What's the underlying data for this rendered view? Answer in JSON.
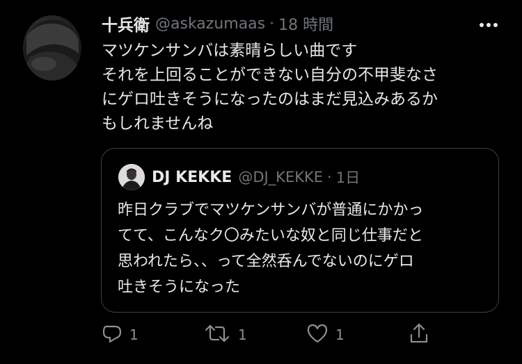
{
  "tweet": {
    "display_name": "十兵衛",
    "handle": "@askazumaas",
    "separator": "·",
    "time": "18 時間",
    "text_lines": [
      "マツケンサンバは素晴らしい曲です",
      "それを上回ることができない自分の不甲斐なさ",
      "にゲロ吐きそうになったのはまだ見込みあるか",
      "もしれませんね"
    ],
    "more_icon": "more-dots-icon"
  },
  "quote": {
    "display_name": "DJ KEKKE",
    "handle": "@DJ_KEKKE",
    "separator": "·",
    "time": "1日",
    "text_lines": [
      "昨日クラブでマツケンサンバが普通にかかっ",
      "てて、こんなク〇みたいな奴と同じ仕事だと",
      "思われたら、、って全然呑んでないのにゲロ",
      "吐きそうになった"
    ]
  },
  "actions": {
    "reply": {
      "icon": "reply-icon",
      "count": "1"
    },
    "retweet": {
      "icon": "retweet-icon",
      "count": "1"
    },
    "like": {
      "icon": "heart-icon",
      "count": "1"
    },
    "share": {
      "icon": "share-icon"
    }
  },
  "colors": {
    "background": "#000000",
    "text_primary": "#e7e9ea",
    "text_secondary": "#71767b",
    "border": "#3c4043"
  }
}
